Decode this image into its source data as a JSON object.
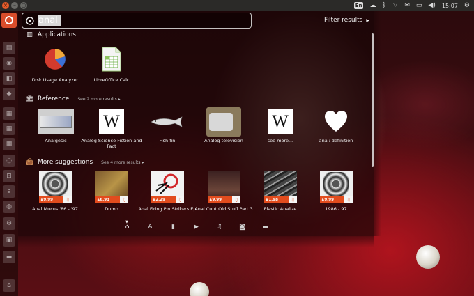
{
  "top_panel": {
    "keyboard_layout": "En",
    "time": "15:07",
    "icons": [
      "cloud-icon",
      "bluetooth-icon",
      "wifi-icon",
      "mail-icon",
      "battery-icon",
      "volume-icon",
      "power-gear-icon"
    ]
  },
  "search": {
    "query": "anal",
    "filter_label": "Filter results"
  },
  "categories": {
    "applications": {
      "title": "Applications",
      "items": [
        {
          "label": "Disk Usage Analyzer"
        },
        {
          "label": "LibreOffice Calc"
        }
      ]
    },
    "reference": {
      "title": "Reference",
      "see_more": "See 2 more results",
      "items": [
        {
          "label": "Analgesic"
        },
        {
          "label": "Analog Science Fiction and Fact"
        },
        {
          "label": "Fish fin"
        },
        {
          "label": "Analog television"
        },
        {
          "label": "see more..."
        },
        {
          "label": "anal: definition"
        }
      ]
    },
    "suggestions": {
      "title": "More suggestions",
      "see_more": "See 4 more results",
      "items": [
        {
          "label": "Anal Mucus '86 - '97",
          "price": "£9.99"
        },
        {
          "label": "Dump",
          "price": "£6.93"
        },
        {
          "label": "Anal Firing Pin Strikers Ep",
          "price": "£2.29"
        },
        {
          "label": "Anal Cunt Old Stuff Part 3",
          "price": "£9.99"
        },
        {
          "label": "Plastic Analize",
          "price": "£1.98"
        },
        {
          "label": "1986 - 97",
          "price": "£9.99"
        }
      ]
    }
  },
  "colors": {
    "accent": "#d94d2b",
    "price_tag": "#e24c1e"
  }
}
